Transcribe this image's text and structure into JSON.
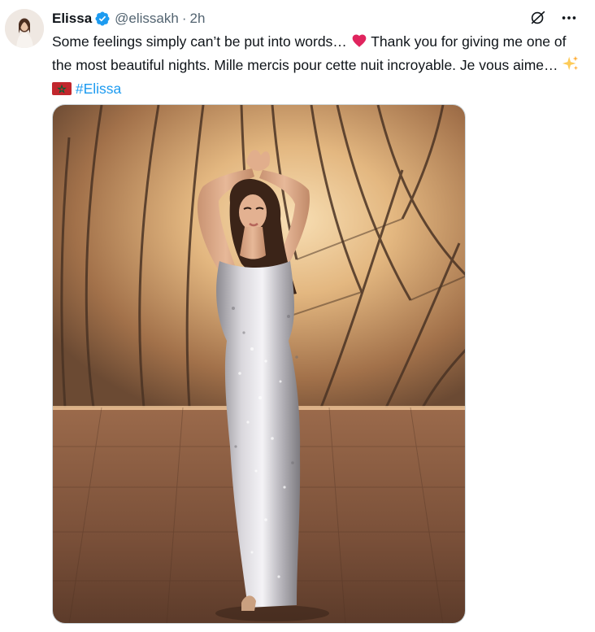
{
  "author": {
    "name": "Elissa",
    "handle": "@elissakh",
    "separator": "·",
    "time": "2h",
    "verified": true
  },
  "tweet": {
    "text_part1": "Some feelings simply can’t be put into words… ",
    "text_part2": " Thank you for giving me one of the most beautiful nights. Mille mercis pour cette nuit incroyable. Je vous aime… ",
    "hashtag": "#Elissa",
    "emojis": [
      "red-heart",
      "sparkles",
      "flag-morocco"
    ]
  },
  "icons": {
    "grok": "grok-icon",
    "more": "more-options-icon"
  },
  "colors": {
    "text": "#0f1419",
    "secondary": "#536471",
    "accent": "#1d9bf0",
    "heart": "#e0245e"
  }
}
